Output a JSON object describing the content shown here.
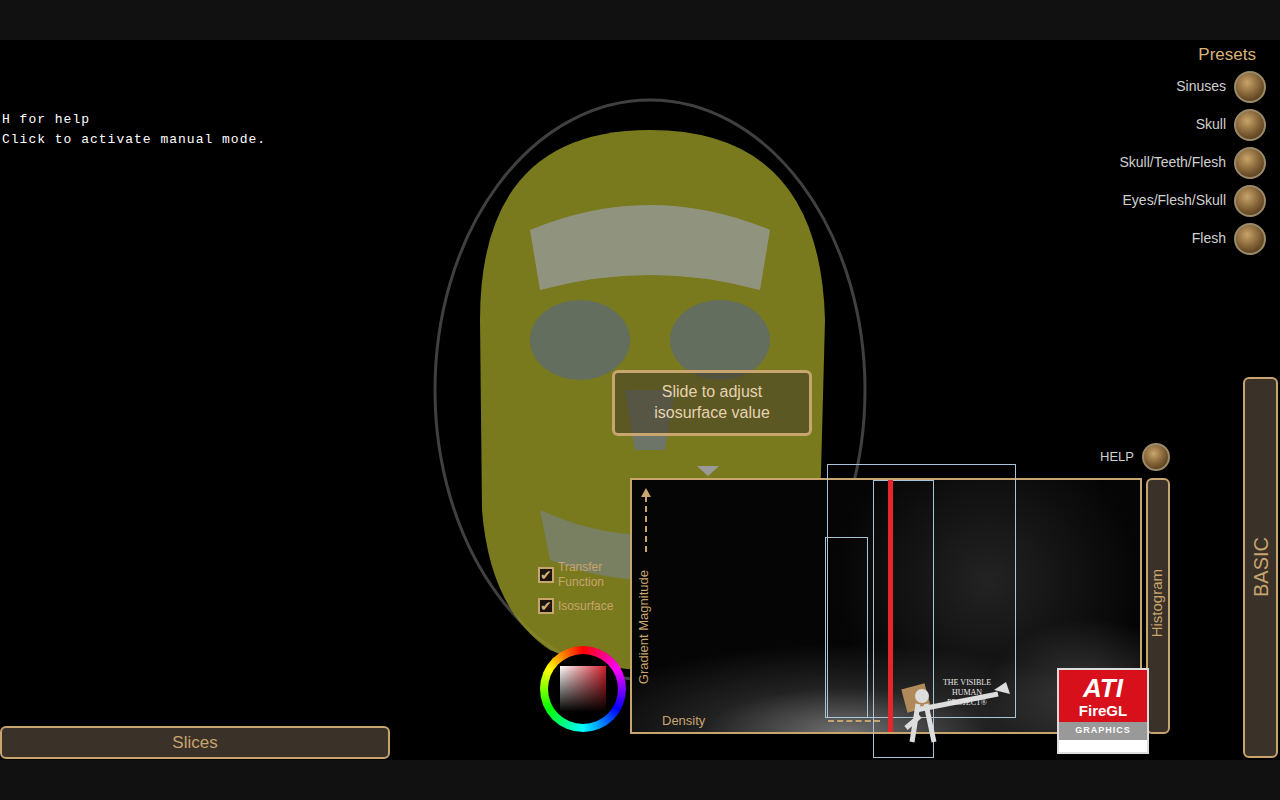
{
  "help_text": [
    "H for help",
    "Click to activate manual mode."
  ],
  "presets": {
    "title": "Presets",
    "items": [
      {
        "label": "Sinuses"
      },
      {
        "label": "Skull"
      },
      {
        "label": "Skull/Teeth/Flesh"
      },
      {
        "label": "Eyes/Flesh/Skull"
      },
      {
        "label": "Flesh"
      }
    ]
  },
  "tooltip": {
    "text": "Slide to adjust isosurface value"
  },
  "toggles": [
    {
      "label": "Transfer Function",
      "checked": true
    },
    {
      "label": "Isosurface",
      "checked": true
    }
  ],
  "color_picker": {
    "color": "#d0202a"
  },
  "histogram": {
    "tab": "Histogram",
    "y_axis": "Gradient Magnitude",
    "x_axis": "Density",
    "isosurface_level": 0.5,
    "widgets": [
      {
        "low": 0.38,
        "high": 0.75,
        "height": 1.0
      },
      {
        "low": 0.47,
        "high": 0.59,
        "height": 1.0
      },
      {
        "low": 0.377,
        "high": 0.46,
        "height": 0.72
      }
    ]
  },
  "help": {
    "label": "HELP"
  },
  "mode_tab": {
    "label": "BASIC"
  },
  "slices": {
    "label": "Slices"
  },
  "logos": {
    "visible_human": "THE VISIBLE HUMAN PROJECT®",
    "ati": "ATI",
    "firegl": "FireGL",
    "graphics": "GRAPHICS"
  }
}
